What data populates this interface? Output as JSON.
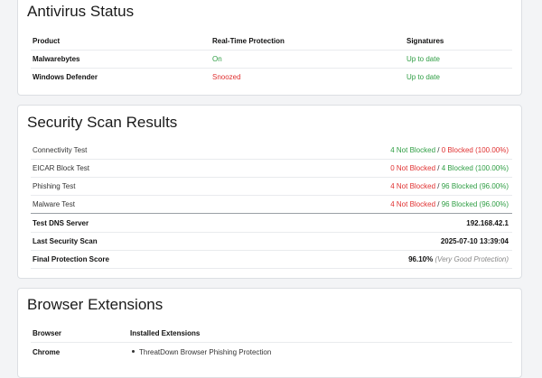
{
  "antivirus": {
    "title": "Antivirus Status",
    "headers": {
      "product": "Product",
      "realtime": "Real-Time Protection",
      "signatures": "Signatures"
    },
    "rows": [
      {
        "product": "Malwarebytes",
        "realtime": "On",
        "signatures": "Up to date"
      },
      {
        "product": "Windows Defender",
        "realtime": "Snoozed",
        "signatures": "Up to date"
      }
    ]
  },
  "scan": {
    "title": "Security Scan Results",
    "tests": [
      {
        "name": "Connectivity Test",
        "part1": "4 Not Blocked",
        "sep": "/",
        "part2": "0 Blocked (100.00%)"
      },
      {
        "name": "EICAR Block Test",
        "part1": "0 Not Blocked",
        "sep": "/",
        "part2": "4 Blocked (100.00%)"
      },
      {
        "name": "Phishing Test",
        "part1": "4 Not Blocked",
        "sep": "/",
        "part2": "96 Blocked (96.00%)"
      },
      {
        "name": "Malware Test",
        "part1": "4 Not Blocked",
        "sep": "/",
        "part2": "96 Blocked (96.00%)"
      }
    ],
    "dns_label": "Test DNS Server",
    "dns_value": "192.168.42.1",
    "last_scan_label": "Last Security Scan",
    "last_scan_value": "2025-07-10 13:39:04",
    "score_label": "Final Protection Score",
    "score_value": "96.10%",
    "score_note": "(Very Good Protection)"
  },
  "extensions": {
    "title": "Browser Extensions",
    "headers": {
      "browser": "Browser",
      "installed": "Installed Extensions"
    },
    "rows": [
      {
        "browser": "Chrome",
        "extension": "ThreatDown Browser Phishing Protection"
      }
    ]
  },
  "colors": {
    "good": "#2f9e44",
    "bad": "#e03131"
  }
}
